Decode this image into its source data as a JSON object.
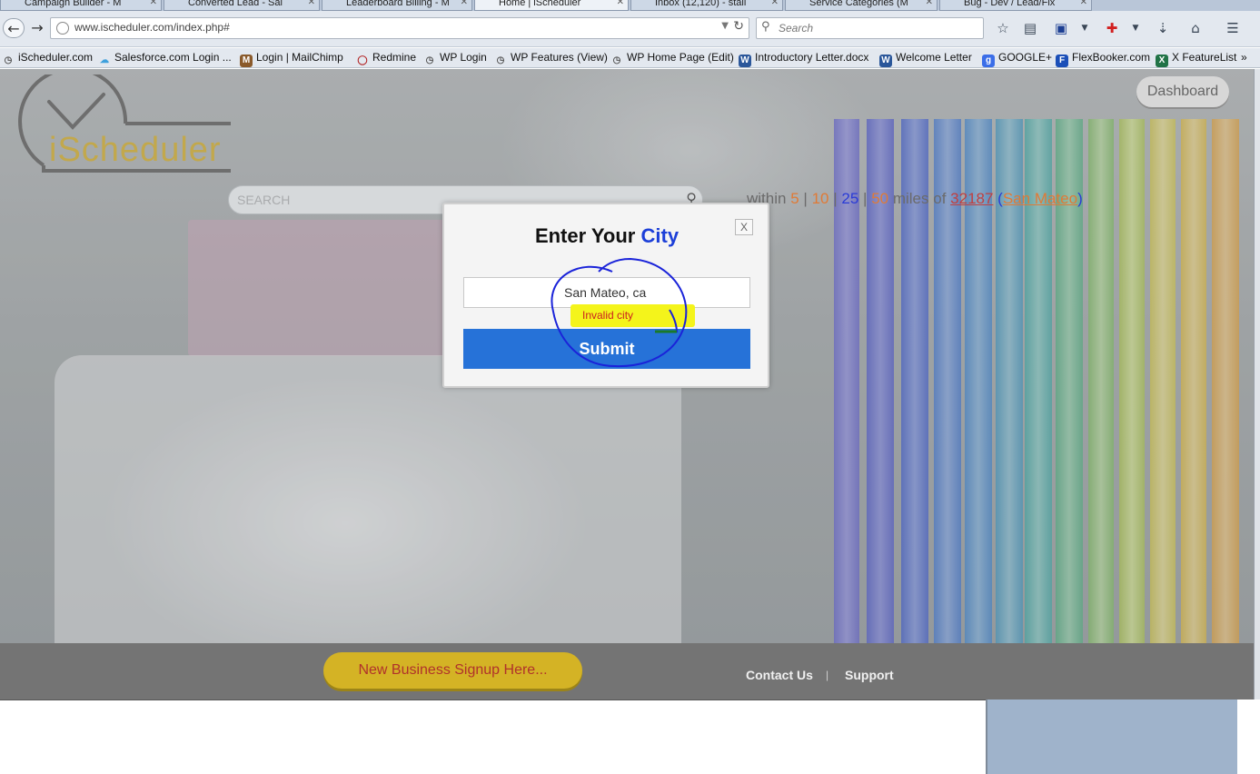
{
  "browser": {
    "tabs": [
      {
        "label": "Campaign Builder - M"
      },
      {
        "label": "Converted Lead - Sal"
      },
      {
        "label": "Leaderboard Billing - M"
      },
      {
        "label": "Home | iScheduler"
      },
      {
        "label": "Inbox (12,120) - stall"
      },
      {
        "label": "Service Categories (M"
      },
      {
        "label": "Bug - Dev / Lead/Fix"
      }
    ],
    "url": "www.ischeduler.com/index.php#",
    "search_placeholder": "Search",
    "bookmarks": [
      {
        "label": "iScheduler.com",
        "icon": "clock-icon",
        "color": "#555555"
      },
      {
        "label": "Salesforce.com Login ...",
        "icon": "cloud-icon",
        "color": "#3ea0dc"
      },
      {
        "label": "Login | MailChimp",
        "icon": "chimp-icon",
        "color": "#8a5a2b"
      },
      {
        "label": "Redmine",
        "icon": "redmine-icon",
        "color": "#b22222"
      },
      {
        "label": "WP Login",
        "icon": "clock-icon",
        "color": "#555555"
      },
      {
        "label": "WP Features (View)",
        "icon": "clock-icon",
        "color": "#555555"
      },
      {
        "label": "WP Home Page (Edit)",
        "icon": "clock-icon",
        "color": "#555555"
      },
      {
        "label": "Introductory Letter.docx",
        "icon": "word-icon",
        "color": "#2b579a"
      },
      {
        "label": "Welcome Letter",
        "icon": "word-icon",
        "color": "#2b579a"
      },
      {
        "label": "GOOGLE+",
        "icon": "google-icon",
        "color": "#3b6ee8"
      },
      {
        "label": "FlexBooker.com",
        "icon": "flexbooker-icon",
        "color": "#1b4fb8"
      },
      {
        "label": "X FeatureList",
        "icon": "excel-icon",
        "color": "#217346"
      }
    ],
    "bookmarks_overflow": "»"
  },
  "page": {
    "logo_text": "iScheduler",
    "dashboard_label": "Dashboard",
    "search_placeholder": "SEARCH",
    "radius": {
      "prefix": "within",
      "options": [
        "5",
        "10",
        "25",
        "50"
      ],
      "middle": "miles of",
      "zip": "32187",
      "city": "San Mateo"
    },
    "footer": {
      "signup_label": "New Business Signup Here...",
      "contact_label": "Contact Us",
      "separator": "|",
      "support_label": "Support"
    }
  },
  "modal": {
    "title_prefix": "Enter Your",
    "title_highlight": "City",
    "close_label": "X",
    "city_value": "San Mateo, ca",
    "error_message": "Invalid city",
    "submit_label": "Submit"
  },
  "colors": {
    "submit_blue": "#2672d8",
    "title_blue": "#1c3fd8",
    "error_red": "#cc1f1f",
    "highlight_yellow": "#f4f41b",
    "annotation_blue": "#1a23d9",
    "signup_gold": "#d4b325"
  }
}
